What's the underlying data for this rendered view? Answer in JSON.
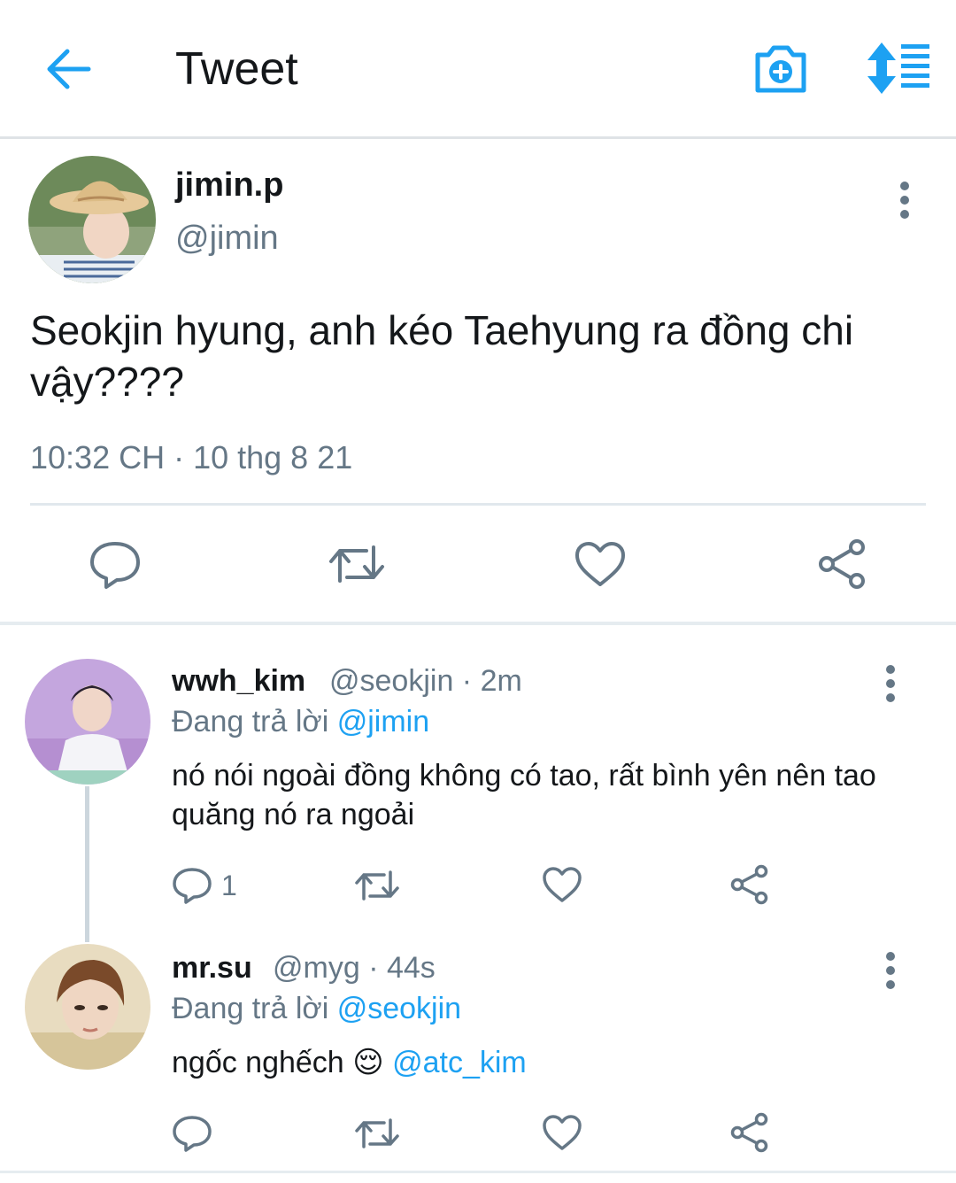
{
  "header": {
    "title": "Tweet",
    "icons": [
      "back-arrow-icon",
      "camera-icon",
      "sort-icon"
    ],
    "accent_color": "#1da1f2"
  },
  "tweet": {
    "display_name": "jimin.p",
    "handle": "@jimin",
    "text": "Seokjin hyung, anh kéo Taehyung ra đồng chi vậy????",
    "timestamp": "10:32 CH · 10 thg 8 21",
    "actions": [
      "reply-icon",
      "retweet-icon",
      "like-icon",
      "share-icon"
    ]
  },
  "replies": [
    {
      "display_name": "wwh_kim",
      "meta": "@seokjin · 2m",
      "reply_prefix": "Đang trả lời",
      "reply_to": "@jimin",
      "text": "nó nói ngoài đồng không có tao, rất bình yên nên tao quăng nó ra ngoải",
      "reply_count": "1"
    },
    {
      "display_name": "mr.su",
      "meta": "@myg · 44s",
      "reply_prefix": "Đang trả lời",
      "reply_to": "@seokjin",
      "text": "ngốc nghếch",
      "emoji": "😌",
      "mention": "@atc_kim"
    }
  ]
}
